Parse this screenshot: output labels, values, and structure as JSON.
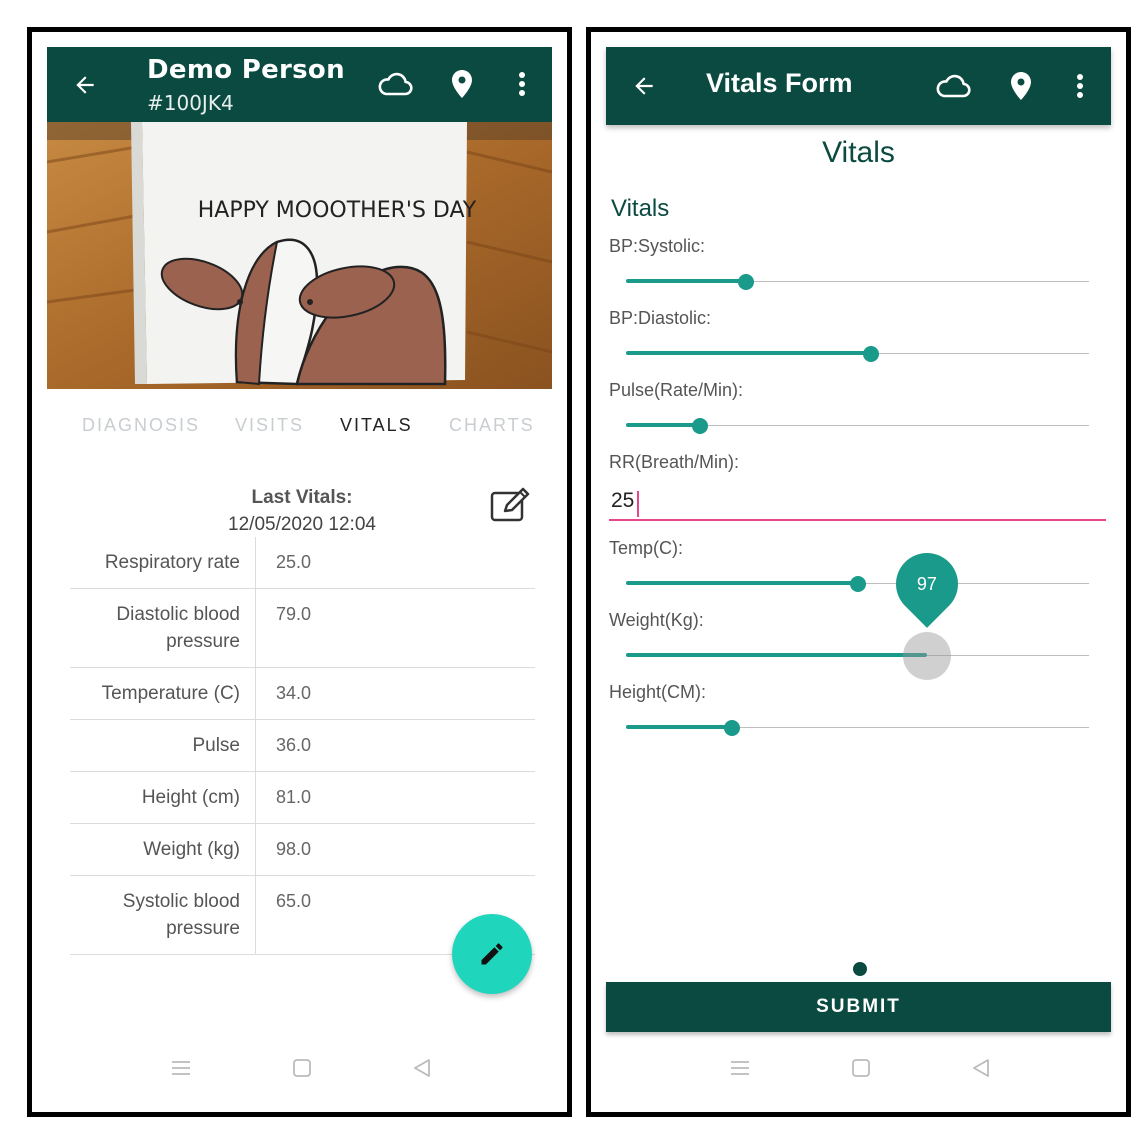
{
  "colors": {
    "appbar": "#0b4a40",
    "accent": "#1a9a8a",
    "fab": "#1fd6bd",
    "input_focus": "#e8468a"
  },
  "left": {
    "header": {
      "name": "Demo Person",
      "id": "#100JK4",
      "icons": [
        "back-arrow-icon",
        "cloud-icon",
        "location-pin-icon",
        "more-vert-icon"
      ]
    },
    "hero": {
      "card_text": "HAPPY MOOOTHER'S DAY"
    },
    "tabs": [
      "DIAGNOSIS",
      "VISITS",
      "VITALS",
      "CHARTS"
    ],
    "active_tab": "VITALS",
    "last_vitals": {
      "label": "Last Vitals:",
      "timestamp": "12/05/2020 12:04"
    },
    "vitals": [
      {
        "label": "Respiratory rate",
        "value": "25.0"
      },
      {
        "label": "Diastolic blood pressure",
        "value": "79.0"
      },
      {
        "label": "Temperature (C)",
        "value": "34.0"
      },
      {
        "label": "Pulse",
        "value": "36.0"
      },
      {
        "label": "Height (cm)",
        "value": "81.0"
      },
      {
        "label": "Weight (kg)",
        "value": "98.0"
      },
      {
        "label": "Systolic blood pressure",
        "value": "65.0"
      }
    ]
  },
  "right": {
    "header": {
      "title": "Vitals Form",
      "icons": [
        "back-arrow-icon",
        "cloud-icon",
        "location-pin-icon",
        "more-vert-icon"
      ]
    },
    "heading": "Vitals",
    "section": "Vitals",
    "fields": {
      "systolic": {
        "label": "BP:Systolic:",
        "level": 0.26
      },
      "diastolic": {
        "label": "BP:Diastolic:",
        "level": 0.53
      },
      "pulse": {
        "label": "Pulse(Rate/Min):",
        "level": 0.16
      },
      "rr": {
        "label": "RR(Breath/Min):",
        "value": "25"
      },
      "temp": {
        "label": "Temp(C):",
        "level": 0.5
      },
      "weight": {
        "label": "Weight(Kg):",
        "level": 0.65,
        "bubble": "97"
      },
      "height": {
        "label": "Height(CM):",
        "level": 0.23
      }
    },
    "submit_label": "SUBMIT"
  }
}
